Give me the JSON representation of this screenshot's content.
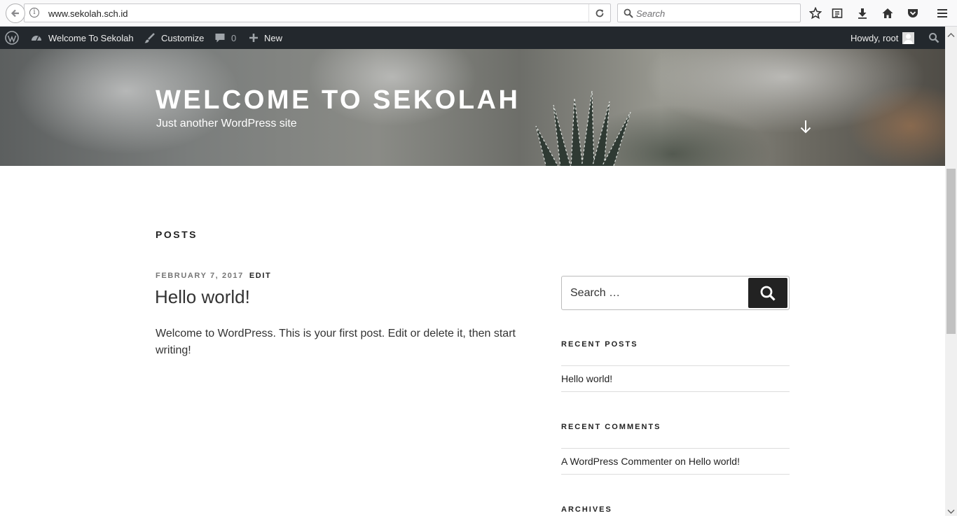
{
  "browser": {
    "url": "www.sekolah.sch.id",
    "search_placeholder": "Search"
  },
  "adminbar": {
    "site_name": "Welcome To Sekolah",
    "customize": "Customize",
    "comments_count": "0",
    "new": "New",
    "howdy": "Howdy, root"
  },
  "header": {
    "title": "WELCOME TO SEKOLAH",
    "description": "Just another WordPress site"
  },
  "main": {
    "section_label": "POSTS",
    "post": {
      "date": "FEBRUARY 7, 2017",
      "edit": "EDIT",
      "title": "Hello world!",
      "excerpt": "Welcome to WordPress. This is your first post. Edit or delete it, then start writing!"
    }
  },
  "sidebar": {
    "search_placeholder": "Search …",
    "recent_posts_title": "RECENT POSTS",
    "recent_posts": [
      "Hello world!"
    ],
    "recent_comments_title": "RECENT COMMENTS",
    "comment_author": "A WordPress Commenter",
    "comment_on": "on",
    "comment_post": "Hello world!",
    "archives_title": "ARCHIVES"
  },
  "colors": {
    "adminbar_bg": "#23282d",
    "text": "#222222",
    "meta_gray": "#767676"
  }
}
